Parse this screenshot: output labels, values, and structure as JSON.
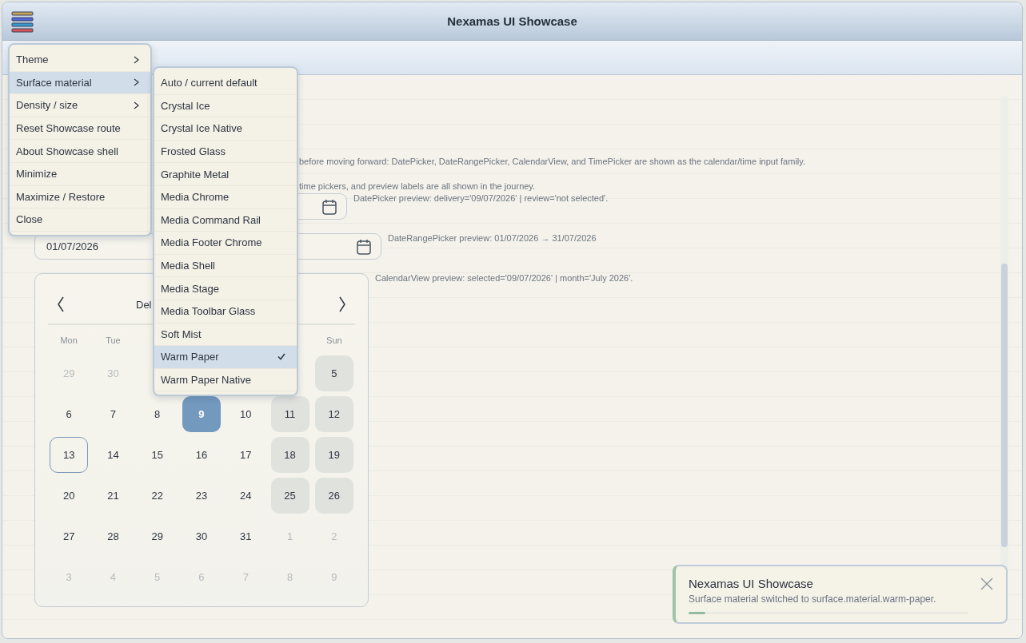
{
  "window": {
    "title": "Nexamas UI Showcase"
  },
  "content": {
    "description_lines": [
      "before moving forward: DatePicker, DateRangePicker, CalendarView, and TimePicker are shown as the calendar/time input family.",
      "time pickers, and preview labels are all shown in the journey."
    ],
    "date_picker": {
      "preview": "DatePicker preview: delivery='09/07/2026' | review='not selected'."
    },
    "date_range_picker": {
      "start": "01/07/2026",
      "preview": "DateRangePicker preview: 01/07/2026 → 31/07/2026"
    },
    "calendar": {
      "title": "Del",
      "preview": "CalendarView preview: selected='09/07/2026' | month='July 2026'.",
      "weekdays": [
        {
          "kind": "label",
          "label": "Mon"
        },
        {
          "kind": "label",
          "label": "Tue"
        },
        {
          "kind": "hidden"
        },
        {
          "kind": "hidden"
        },
        {
          "kind": "hidden"
        },
        {
          "kind": "hidden"
        },
        {
          "kind": "label",
          "label": "Sun"
        }
      ],
      "weeks": [
        {
          "days": [
            {
              "kind": "day",
              "day": "29",
              "muted": true,
              "blocked": false,
              "selected": false,
              "today": false
            },
            {
              "kind": "day",
              "day": "30",
              "muted": true,
              "blocked": false,
              "selected": false,
              "today": false
            },
            {
              "kind": "hidden"
            },
            {
              "kind": "hidden"
            },
            {
              "kind": "hidden"
            },
            {
              "kind": "hidden"
            },
            {
              "kind": "day",
              "day": "5",
              "muted": false,
              "blocked": true,
              "selected": false,
              "today": false
            }
          ]
        },
        {
          "days": [
            {
              "kind": "day",
              "day": "6",
              "muted": false,
              "blocked": false,
              "selected": false,
              "today": false
            },
            {
              "kind": "day",
              "day": "7",
              "muted": false,
              "blocked": false,
              "selected": false,
              "today": false
            },
            {
              "kind": "day",
              "day": "8",
              "muted": false,
              "blocked": false,
              "selected": false,
              "today": false
            },
            {
              "kind": "day",
              "day": "9",
              "muted": false,
              "blocked": false,
              "selected": true,
              "today": false
            },
            {
              "kind": "day",
              "day": "10",
              "muted": false,
              "blocked": false,
              "selected": false,
              "today": false
            },
            {
              "kind": "day",
              "day": "11",
              "muted": false,
              "blocked": true,
              "selected": false,
              "today": false
            },
            {
              "kind": "day",
              "day": "12",
              "muted": false,
              "blocked": true,
              "selected": false,
              "today": false
            }
          ]
        },
        {
          "days": [
            {
              "kind": "day",
              "day": "13",
              "muted": false,
              "blocked": false,
              "selected": false,
              "today": true
            },
            {
              "kind": "day",
              "day": "14",
              "muted": false,
              "blocked": false,
              "selected": false,
              "today": false
            },
            {
              "kind": "day",
              "day": "15",
              "muted": false,
              "blocked": false,
              "selected": false,
              "today": false
            },
            {
              "kind": "day",
              "day": "16",
              "muted": false,
              "blocked": false,
              "selected": false,
              "today": false
            },
            {
              "kind": "day",
              "day": "17",
              "muted": false,
              "blocked": false,
              "selected": false,
              "today": false
            },
            {
              "kind": "day",
              "day": "18",
              "muted": false,
              "blocked": true,
              "selected": false,
              "today": false
            },
            {
              "kind": "day",
              "day": "19",
              "muted": false,
              "blocked": true,
              "selected": false,
              "today": false
            }
          ]
        },
        {
          "days": [
            {
              "kind": "day",
              "day": "20",
              "muted": false,
              "blocked": false,
              "selected": false,
              "today": false
            },
            {
              "kind": "day",
              "day": "21",
              "muted": false,
              "blocked": false,
              "selected": false,
              "today": false
            },
            {
              "kind": "day",
              "day": "22",
              "muted": false,
              "blocked": false,
              "selected": false,
              "today": false
            },
            {
              "kind": "day",
              "day": "23",
              "muted": false,
              "blocked": false,
              "selected": false,
              "today": false
            },
            {
              "kind": "day",
              "day": "24",
              "muted": false,
              "blocked": false,
              "selected": false,
              "today": false
            },
            {
              "kind": "day",
              "day": "25",
              "muted": false,
              "blocked": true,
              "selected": false,
              "today": false
            },
            {
              "kind": "day",
              "day": "26",
              "muted": false,
              "blocked": true,
              "selected": false,
              "today": false
            }
          ]
        },
        {
          "days": [
            {
              "kind": "day",
              "day": "27",
              "muted": false,
              "blocked": false,
              "selected": false,
              "today": false
            },
            {
              "kind": "day",
              "day": "28",
              "muted": false,
              "blocked": false,
              "selected": false,
              "today": false
            },
            {
              "kind": "day",
              "day": "29",
              "muted": false,
              "blocked": false,
              "selected": false,
              "today": false
            },
            {
              "kind": "day",
              "day": "30",
              "muted": false,
              "blocked": false,
              "selected": false,
              "today": false
            },
            {
              "kind": "day",
              "day": "31",
              "muted": false,
              "blocked": false,
              "selected": false,
              "today": false
            },
            {
              "kind": "day",
              "day": "1",
              "muted": true,
              "blocked": false,
              "selected": false,
              "today": false
            },
            {
              "kind": "day",
              "day": "2",
              "muted": true,
              "blocked": false,
              "selected": false,
              "today": false
            }
          ]
        },
        {
          "days": [
            {
              "kind": "day",
              "day": "3",
              "muted": true,
              "blocked": false,
              "selected": false,
              "today": false
            },
            {
              "kind": "day",
              "day": "4",
              "muted": true,
              "blocked": false,
              "selected": false,
              "today": false
            },
            {
              "kind": "day",
              "day": "5",
              "muted": true,
              "blocked": false,
              "selected": false,
              "today": false
            },
            {
              "kind": "day",
              "day": "6",
              "muted": true,
              "blocked": false,
              "selected": false,
              "today": false
            },
            {
              "kind": "day",
              "day": "7",
              "muted": true,
              "blocked": false,
              "selected": false,
              "today": false
            },
            {
              "kind": "day",
              "day": "8",
              "muted": true,
              "blocked": false,
              "selected": false,
              "today": false
            },
            {
              "kind": "day",
              "day": "9",
              "muted": true,
              "blocked": false,
              "selected": false,
              "today": false
            }
          ]
        }
      ]
    }
  },
  "menu": {
    "items": [
      {
        "label": "Theme",
        "submenu": true,
        "selected": false
      },
      {
        "label": "Surface material",
        "submenu": true,
        "selected": true
      },
      {
        "label": "Density / size",
        "submenu": true,
        "selected": false
      },
      {
        "label": "Reset Showcase route",
        "submenu": false,
        "selected": false
      },
      {
        "label": "About Showcase shell",
        "submenu": false,
        "selected": false
      },
      {
        "label": "Minimize",
        "submenu": false,
        "selected": false
      },
      {
        "label": "Maximize / Restore",
        "submenu": false,
        "selected": false
      },
      {
        "label": "Close",
        "submenu": false,
        "selected": false
      }
    ]
  },
  "submenu": {
    "items": [
      {
        "label": "Auto / current default",
        "selected": false,
        "checked": false
      },
      {
        "label": "Crystal Ice",
        "selected": false,
        "checked": false
      },
      {
        "label": "Crystal Ice Native",
        "selected": false,
        "checked": false
      },
      {
        "label": "Frosted Glass",
        "selected": false,
        "checked": false
      },
      {
        "label": "Graphite Metal",
        "selected": false,
        "checked": false
      },
      {
        "label": "Media Chrome",
        "selected": false,
        "checked": false
      },
      {
        "label": "Media Command Rail",
        "selected": false,
        "checked": false
      },
      {
        "label": "Media Footer Chrome",
        "selected": false,
        "checked": false
      },
      {
        "label": "Media Shell",
        "selected": false,
        "checked": false
      },
      {
        "label": "Media Stage",
        "selected": false,
        "checked": false
      },
      {
        "label": "Media Toolbar Glass",
        "selected": false,
        "checked": false
      },
      {
        "label": "Soft Mist",
        "selected": false,
        "checked": false
      },
      {
        "label": "Warm Paper",
        "selected": true,
        "checked": true
      },
      {
        "label": "Warm Paper Native",
        "selected": false,
        "checked": false
      }
    ]
  },
  "toast": {
    "title": "Nexamas UI Showcase",
    "message": "Surface material switched to surface.material.warm-paper.",
    "level": 0.06
  }
}
